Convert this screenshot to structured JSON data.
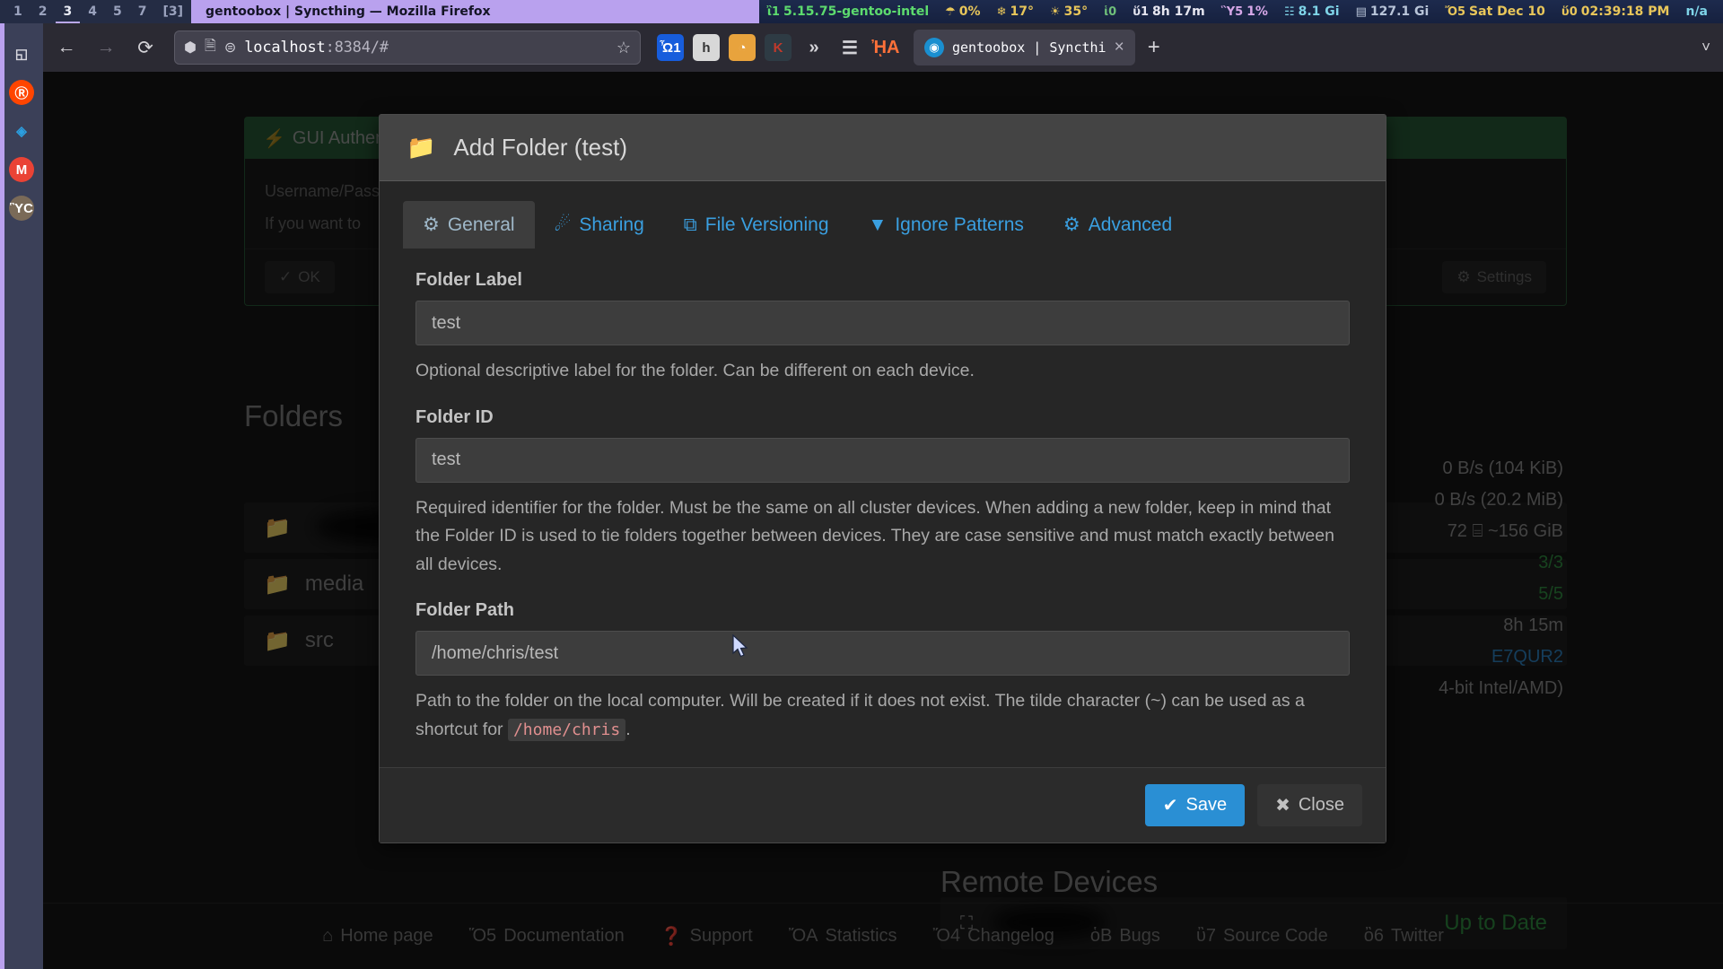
{
  "statusbar": {
    "workspaces": [
      {
        "label": "1",
        "state": "inactive"
      },
      {
        "label": "2",
        "state": "inactive"
      },
      {
        "label": "3",
        "state": "active"
      },
      {
        "label": "4",
        "state": "inactive"
      },
      {
        "label": "5",
        "state": "inactive"
      },
      {
        "label": "7",
        "state": "inactive"
      },
      {
        "label": "[3]",
        "state": "inactive"
      }
    ],
    "window_title": "gentoobox | Syncthing — Mozilla Firefox",
    "items": [
      {
        "icon": "thermometer-icon",
        "glyph": "ἲ1",
        "text": "5.15.75-gentoo-intel",
        "color": "#5ddb6e"
      },
      {
        "icon": "umbrella-icon",
        "glyph": "☂",
        "text": "0%",
        "color": "#e8c65a"
      },
      {
        "icon": "snowflake-icon",
        "glyph": "❄",
        "text": "17°",
        "color": "#e8c65a"
      },
      {
        "icon": "sun-icon",
        "glyph": "☀",
        "text": "35°",
        "color": "#e8c65a"
      },
      {
        "icon": "globe-icon",
        "glyph": "ἱ0",
        "text": "",
        "color": "#6fc07a"
      },
      {
        "icon": "uptime-icon",
        "glyph": "ὕ1",
        "text": "8h 17m",
        "color": "#e6e6f0"
      },
      {
        "icon": "monitor-icon",
        "glyph": "Ὓ5",
        "text": "1%",
        "color": "#d7a8e8"
      },
      {
        "icon": "memory-icon",
        "glyph": "☷",
        "text": "8.1 Gi",
        "color": "#7fd4e8"
      },
      {
        "icon": "disk-icon",
        "glyph": "▤",
        "text": "127.1 Gi",
        "color": "#b8c4d8"
      },
      {
        "icon": "calendar-icon",
        "glyph": "Ὄ5",
        "text": "Sat Dec 10",
        "color": "#e8c65a"
      },
      {
        "icon": "clock-icon",
        "glyph": "ὕ0",
        "text": "02:39:18 PM",
        "color": "#e8c65a"
      },
      {
        "icon": "na-indicator",
        "glyph": "",
        "text": "n/a",
        "color": "#7fd4e8"
      }
    ]
  },
  "dock": {
    "items": [
      {
        "name": "file-manager-icon",
        "glyph": "◱",
        "bg": "transparent",
        "fg": "#d8d8e0"
      },
      {
        "name": "reddit-icon",
        "glyph": "Ⓡ",
        "bg": "#ff4500",
        "fg": "#ffffff"
      },
      {
        "name": "vs-code-icon",
        "glyph": "◈",
        "bg": "transparent",
        "fg": "#2b9fe0"
      },
      {
        "name": "gmail-icon",
        "glyph": "M",
        "bg": "#ea4335",
        "fg": "#ffffff"
      },
      {
        "name": "gimp-icon",
        "glyph": "ὛC",
        "bg": "#7a6a58",
        "fg": "#ffffff"
      }
    ]
  },
  "browser": {
    "back_icon": "back-arrow-icon",
    "forward_icon": "forward-arrow-icon",
    "reload_icon": "reload-icon",
    "url": "localhost",
    "url_suffix": ":8384/#",
    "shield_icon": "shield-icon",
    "page_icon": "page-icon",
    "permissions_icon": "permissions-icon",
    "bookmark_icon": "star-icon",
    "extensions": [
      {
        "name": "bitwarden-icon",
        "glyph": "Ὦ1",
        "bg": "#175ddc",
        "fg": "#ffffff"
      },
      {
        "name": "https-everywhere-icon",
        "glyph": "h",
        "bg": "#d8d8d8",
        "fg": "#333333"
      },
      {
        "name": "ublock-icon",
        "glyph": "◔",
        "bg": "#e8a33d",
        "fg": "#ffffff"
      },
      {
        "name": "kagi-icon",
        "glyph": "K",
        "bg": "#2e3b44",
        "fg": "#c0392b"
      },
      {
        "name": "overflow-icon",
        "glyph": "»",
        "bg": "transparent",
        "fg": "#d4d3d8"
      },
      {
        "name": "hamburger-menu-icon",
        "glyph": "☰",
        "bg": "transparent",
        "fg": "#d4d3d8"
      },
      {
        "name": "firefox-account-icon",
        "glyph": "ᾘA",
        "bg": "transparent",
        "fg": "#ff7139"
      }
    ],
    "tab": {
      "favicon": "syncthing-favicon",
      "title": "gentoobox | Syncthi",
      "close_label": "×"
    },
    "new_tab_label": "+",
    "list_all_tabs_icon": "chevron-down-icon"
  },
  "page": {
    "gui_auth": {
      "icon": "bolt-icon",
      "title": "GUI Authentication",
      "line1": "Username/Password",
      "line2": "If you want to",
      "ok_label": "OK",
      "ok_icon": "check-circle-icon",
      "settings_label": "Settings",
      "settings_icon": "gear-icon"
    },
    "folders_title": "Folders",
    "folders": [
      {
        "name": "",
        "redacted": true,
        "icon": "folder-icon"
      },
      {
        "name": "media",
        "redacted": false,
        "icon": "folder-icon"
      },
      {
        "name": "src",
        "redacted": false,
        "icon": "folder-icon"
      }
    ],
    "stats": [
      {
        "value": "0 B/s (104 KiB)",
        "color": "default"
      },
      {
        "value": "0 B/s (20.2 MiB)",
        "color": "default"
      },
      {
        "value": "72   ⌸ ~156 GiB",
        "color": "default"
      },
      {
        "value": "3/3",
        "color": "green"
      },
      {
        "value": "5/5",
        "color": "green"
      },
      {
        "value": "8h 15m",
        "color": "default"
      },
      {
        "value": "E7QUR2",
        "color": "blue"
      },
      {
        "value": "4-bit Intel/AMD)",
        "color": "default"
      }
    ],
    "remote_devices_title": "Remote Devices",
    "remote_devices": [
      {
        "name": "",
        "redacted": true,
        "status": "Up to Date",
        "icon": "device-icon"
      }
    ],
    "footer_links": [
      {
        "label": "Home page",
        "icon": "home-icon"
      },
      {
        "label": "Documentation",
        "icon": "book-icon"
      },
      {
        "label": "Support",
        "icon": "question-circle-icon"
      },
      {
        "label": "Statistics",
        "icon": "bar-chart-icon"
      },
      {
        "label": "Changelog",
        "icon": "file-text-icon"
      },
      {
        "label": "Bugs",
        "icon": "bug-icon"
      },
      {
        "label": "Source Code",
        "icon": "wrench-icon"
      },
      {
        "label": "Twitter",
        "icon": "twitter-icon"
      }
    ]
  },
  "modal": {
    "icon": "folder-icon",
    "title": "Add Folder (test)",
    "tabs": [
      {
        "label": "General",
        "icon": "gear-icon",
        "active": true
      },
      {
        "label": "Sharing",
        "icon": "share-icon",
        "active": false
      },
      {
        "label": "File Versioning",
        "icon": "copy-icon",
        "active": false
      },
      {
        "label": "Ignore Patterns",
        "icon": "filter-icon",
        "active": false
      },
      {
        "label": "Advanced",
        "icon": "gears-icon",
        "active": false
      }
    ],
    "fields": [
      {
        "label": "Folder Label",
        "value": "test",
        "placeholder": "",
        "help": "Optional descriptive label for the folder. Can be different on each device."
      },
      {
        "label": "Folder ID",
        "value": "test",
        "placeholder": "",
        "help": "Required identifier for the folder. Must be the same on all cluster devices. When adding a new folder, keep in mind that the Folder ID is used to tie folders together between devices. They are case sensitive and must match exactly between all devices."
      },
      {
        "label": "Folder Path",
        "value": "/home/chris/test",
        "placeholder": "",
        "help_pre": "Path to the folder on the local computer. Will be created if it does not exist. The tilde character (~) can be used as a shortcut for ",
        "help_code": "/home/chris",
        "help_post": "."
      }
    ],
    "buttons": {
      "save_label": "Save",
      "save_icon": "check-icon",
      "close_label": "Close",
      "close_icon": "x-icon"
    }
  },
  "colors": {
    "accent_blue": "#2a8fd4",
    "tab_link": "#3a9fe0",
    "success_green": "#2f7a46",
    "status_green": "#2e8b3f",
    "modal_bg": "#2b2b2b",
    "taskbar_purple": "#b9a1ee"
  }
}
